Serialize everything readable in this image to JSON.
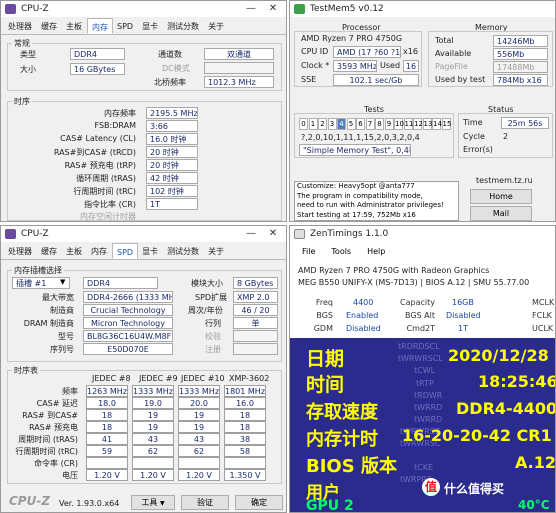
{
  "cpuz_top": {
    "title": "CPU-Z",
    "tabs": [
      "处理器",
      "缓存",
      "主板",
      "内存",
      "SPD",
      "显卡",
      "测试分数",
      "关于"
    ],
    "active_tab": 3,
    "general_title": "常规",
    "type_label": "类型",
    "type_value": "DDR4",
    "size_label": "大小",
    "size_value": "16 GBytes",
    "channel_label": "通道数",
    "channel_value": "双通道",
    "dc_label": "DC模式",
    "dc_value": "",
    "nb_label": "北桥频率",
    "nb_value": "1012.3 MHz",
    "timing_title": "时序",
    "timings": [
      {
        "label": "内存频率",
        "value": "2195.5 MHz"
      },
      {
        "label": "FSB:DRAM",
        "value": "3:66"
      },
      {
        "label": "CAS# Latency (CL)",
        "value": "16.0 时钟"
      },
      {
        "label": "RAS#到CAS# (tRCD)",
        "value": "20 时钟"
      },
      {
        "label": "RAS# 预充电 (tRP)",
        "value": "20 时钟"
      },
      {
        "label": "循环周期 (tRAS)",
        "value": "42 时钟"
      },
      {
        "label": "行周期时间 (tRC)",
        "value": "102 时钟"
      },
      {
        "label": "指令比率 (CR)",
        "value": "1T"
      }
    ],
    "greyed": [
      "内存空闲计时器",
      "总CAS号 (tRDRAM)",
      "行至列 (tRCD)"
    ]
  },
  "testmem": {
    "title": "TestMem5 v0.12",
    "processor_title": "Processor",
    "cpu_name": "AMD Ryzen 7 PRO 4750G",
    "cpu_id_label": "CPU ID",
    "cpu_id_value": "AMD  (17 ?60 ?1)",
    "cpu_id_threads": "x16",
    "clock_label": "Clock *",
    "clock_value": "3593 MHz",
    "used_label": "Used",
    "used_value": "16",
    "sse_label": "SSE",
    "sse_value": "102.1 sec/Gb",
    "memory_title": "Memory",
    "total_label": "Total",
    "total_value": "14246Mb",
    "available_label": "Available",
    "available_value": "556Mb",
    "pagefile_label": "PageFile",
    "pagefile_value": "17488Mb",
    "usedby_label": "Used by test",
    "usedby_value": "784Mb x16",
    "tests_title": "Tests",
    "test_numbers": [
      "0",
      "1",
      "2",
      "3",
      "4",
      "5",
      "6",
      "7",
      "8",
      "9",
      "10",
      "11",
      "12",
      "13",
      "14",
      "15"
    ],
    "active_test": 4,
    "test_sequence": "?,2,0,10,1,11,1,15,2,0,3,2,0,4",
    "test_desc": "\"Simple Memory Test\", 0,4Mb",
    "status_title": "Status",
    "time_label": "Time",
    "time_value": "25m 56s",
    "cycle_label": "Cycle",
    "cycle_value": "2",
    "errors_label": "Error(s)",
    "errors_value": "",
    "log": [
      "Customize: Heavy5opt @anta777",
      "The program in compatibility mode,",
      "need to run with Administrator privileges!",
      "Start testing at 17:59, 752Mb x16"
    ],
    "site": "testmem.tz.ru",
    "btn_home": "Home",
    "btn_mail": "Mail",
    "btn_exit": "Exit"
  },
  "cpuz_bottom": {
    "title": "CPU-Z",
    "tabs": [
      "处理器",
      "缓存",
      "主板",
      "内存",
      "SPD",
      "显卡",
      "测试分数",
      "关于"
    ],
    "active_tab": 4,
    "slot_title": "内存插槽选择",
    "slot_value": "插槽 #1",
    "slot_type": "DDR4",
    "module_size_label": "模块大小",
    "module_size_value": "8 GBytes",
    "max_bw_label": "最大带宽",
    "max_bw_value": "DDR4-2666 (1333 MHz)",
    "spd_ext_label": "SPD扩展",
    "spd_ext_value": "XMP 2.0",
    "mfr_label": "制造商",
    "mfr_value": "Crucial Technology",
    "week_label": "周次/年份",
    "week_value": "46 / 20",
    "dram_label": "DRAM 制造商",
    "dram_value": "Micron Technology",
    "rank_label": "行列",
    "rank_value": "单",
    "model_label": "型号",
    "model_value": "BL8G36C16U4W.M8FE1",
    "check_label": "校验",
    "check_value": "",
    "serial_label": "序列号",
    "serial_value": "E50D070E",
    "reg_label": "注册",
    "reg_value": "",
    "timing_title": "时序表",
    "cols": [
      "JEDEC #8",
      "JEDEC #9",
      "JEDEC #10",
      "XMP-3602"
    ],
    "rows": [
      {
        "label": "频率",
        "values": [
          "1263 MHz",
          "1333 MHz",
          "1333 MHz",
          "1801 MHz"
        ]
      },
      {
        "label": "CAS# 延迟",
        "values": [
          "18.0",
          "19.0",
          "20.0",
          "16.0"
        ]
      },
      {
        "label": "RAS# 到CAS#",
        "values": [
          "18",
          "19",
          "19",
          "18"
        ]
      },
      {
        "label": "RAS# 预充电",
        "values": [
          "18",
          "19",
          "19",
          "18"
        ]
      },
      {
        "label": "周期时间 (tRAS)",
        "values": [
          "41",
          "43",
          "43",
          "38"
        ]
      },
      {
        "label": "行周期时间 (tRC)",
        "values": [
          "59",
          "62",
          "62",
          "58"
        ]
      },
      {
        "label": "命令率 (CR)",
        "values": [
          "",
          "",
          "",
          ""
        ]
      },
      {
        "label": "电压",
        "values": [
          "1.20 V",
          "1.20 V",
          "1.20 V",
          "1.350 V"
        ]
      }
    ],
    "logo": "CPU-Z",
    "version": "Ver. 1.93.0.x64",
    "tools_label": "工具",
    "verify_label": "验证",
    "ok_label": "确定"
  },
  "zentimings": {
    "title": "ZenTimings 1.1.0",
    "menu": [
      "File",
      "Tools",
      "Help"
    ],
    "cpu": "AMD Ryzen 7 PRO 4750G with Radeon Graphics",
    "board": "MEG B550 UNIFY-X (MS-7D13) | BIOS A.12 | SMU 55.77.00",
    "row1": {
      "l1": "Freq",
      "v1": "4400",
      "l2": "Capacity",
      "v2": "16GB",
      "l3": "MCLK"
    },
    "row2": {
      "l1": "BGS",
      "v1": "Enabled",
      "l2": "BGS Alt",
      "v2": "Disabled",
      "l3": "FCLK"
    },
    "row3": {
      "l1": "GDM",
      "v1": "Disabled",
      "l2": "Cmd2T",
      "v2": "1T",
      "l3": "UCLK"
    },
    "faint": [
      "tRDRDSCL",
      "tWRWRSCL",
      "tCWL",
      "tRTP",
      "tRDWR",
      "tWRRD",
      "tWRRD",
      "tWRWRSC",
      "tWRWRSC",
      "tCKE",
      "tWRPRE"
    ]
  },
  "overlay": {
    "lines": [
      {
        "label": "日期",
        "value": "2020/12/28"
      },
      {
        "label": "时间",
        "value": "18:25:46"
      },
      {
        "label": "存取速度",
        "value": "DDR4-4400"
      },
      {
        "label": "内存计时",
        "value": "16-20-20-42 CR1"
      },
      {
        "label": "BIOS 版本",
        "value": "A.12"
      },
      {
        "label": "用户",
        "value": ""
      },
      {
        "label": "GPU 2",
        "value": "40°C"
      }
    ],
    "watermark": "什么值得买"
  }
}
